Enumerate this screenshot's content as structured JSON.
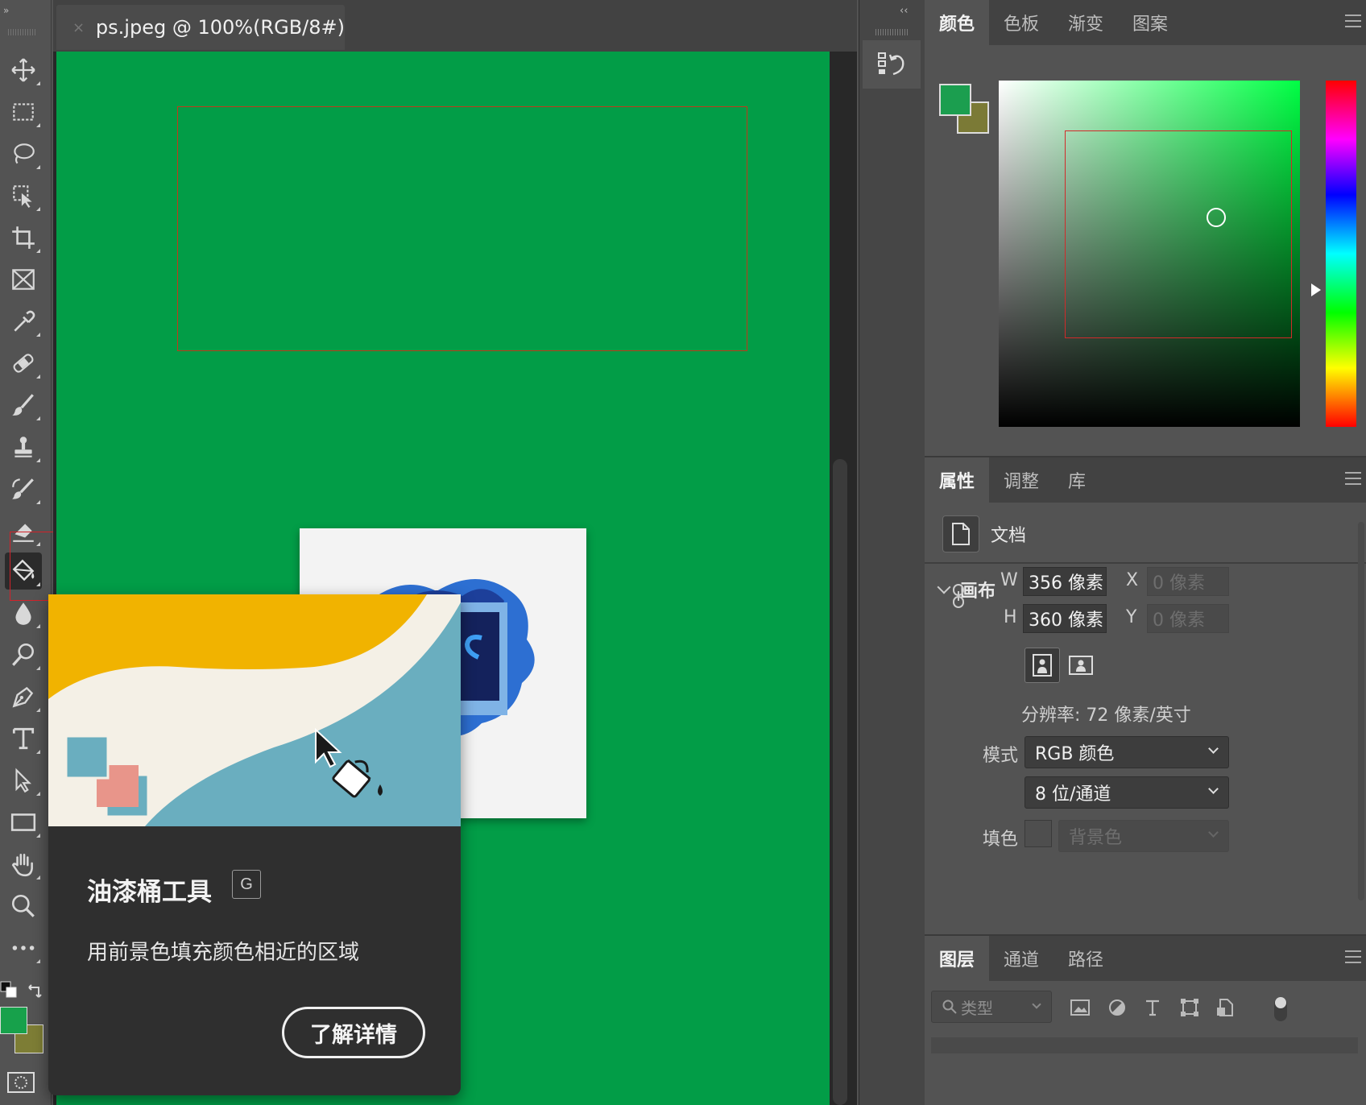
{
  "toolbar": {
    "collapse_glyph": "»",
    "tools": [
      {
        "name": "move-tool",
        "icon": "move-icon"
      },
      {
        "name": "marquee-tool",
        "icon": "rect-marquee-icon"
      },
      {
        "name": "lasso-tool",
        "icon": "lasso-icon"
      },
      {
        "name": "object-select-tool",
        "icon": "object-select-icon"
      },
      {
        "name": "crop-tool",
        "icon": "crop-icon"
      },
      {
        "name": "frame-tool",
        "icon": "frame-icon"
      },
      {
        "name": "eyedropper-tool",
        "icon": "eyedropper-icon"
      },
      {
        "name": "healing-tool",
        "icon": "bandage-icon"
      },
      {
        "name": "brush-tool",
        "icon": "brush-icon"
      },
      {
        "name": "stamp-tool",
        "icon": "stamp-icon"
      },
      {
        "name": "history-brush-tool",
        "icon": "history-brush-icon"
      },
      {
        "name": "eraser-tool",
        "icon": "eraser-icon"
      },
      {
        "name": "paint-bucket-tool",
        "icon": "paint-bucket-icon",
        "active": true
      },
      {
        "name": "blur-tool",
        "icon": "droplet-icon"
      },
      {
        "name": "dodge-tool",
        "icon": "dodge-icon"
      },
      {
        "name": "pen-tool",
        "icon": "pen-icon"
      },
      {
        "name": "type-tool",
        "icon": "type-icon"
      },
      {
        "name": "path-select-tool",
        "icon": "arrow-icon"
      },
      {
        "name": "rectangle-tool",
        "icon": "rectangle-icon"
      },
      {
        "name": "hand-tool",
        "icon": "hand-icon"
      },
      {
        "name": "zoom-tool",
        "icon": "zoom-icon"
      },
      {
        "name": "more-tools",
        "icon": "ellipsis-icon"
      }
    ],
    "foreground_color": "#17a14b",
    "background_color": "#7d7d35"
  },
  "document": {
    "tab_title": "ps.jpeg @ 100%(RGB/8#)",
    "close_glyph": "×",
    "canvas_color": "#029d47"
  },
  "tooltip": {
    "title": "油漆桶工具",
    "shortcut": "G",
    "description": "用前景色填充颜色相近的区域",
    "learn_more": "了解详情"
  },
  "mid_strip": {
    "expand_glyph": "‹‹",
    "history_icon": "history-icon"
  },
  "color_panel": {
    "tabs": [
      "颜色",
      "色板",
      "渐变",
      "图案"
    ],
    "active_tab": 0,
    "foreground": "#1b9e4f",
    "background": "#7b7a36"
  },
  "properties_panel": {
    "tabs": [
      "属性",
      "调整",
      "库"
    ],
    "active_tab": 0,
    "doc_label": "文档",
    "section_title": "画布",
    "w_label": "W",
    "w_value": "356 像素",
    "h_label": "H",
    "h_value": "360 像素",
    "x_label": "X",
    "x_placeholder": "0 像素",
    "y_label": "Y",
    "y_placeholder": "0 像素",
    "resolution": "分辨率: 72 像素/英寸",
    "mode_label": "模式",
    "mode_value": "RGB 颜色",
    "depth_value": "8 位/通道",
    "fill_label": "填色",
    "fill_value": "背景色"
  },
  "layers_panel": {
    "tabs": [
      "图层",
      "通道",
      "路径"
    ],
    "active_tab": 0,
    "filter_placeholder": "类型"
  }
}
